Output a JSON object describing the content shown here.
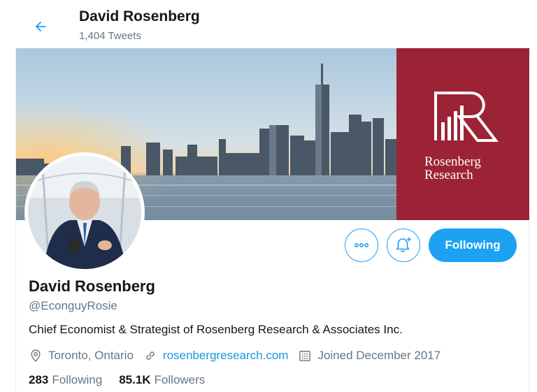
{
  "header": {
    "name": "David Rosenberg",
    "tweet_count": "1,404 Tweets",
    "back_icon": "arrow-left-icon"
  },
  "banner": {
    "brand_line1": "Rosenberg",
    "brand_line2": "Research",
    "brand_color": "#9b2335"
  },
  "actions": {
    "more_icon": "more-dots-icon",
    "notify_icon": "bell-plus-icon",
    "follow_label": "Following"
  },
  "profile": {
    "name": "David Rosenberg",
    "handle": "@EconguyRosie",
    "bio": "Chief Economist & Strategist of Rosenberg Research & Associates Inc.",
    "location": "Toronto, Ontario",
    "website": "rosenbergresearch.com",
    "joined": "Joined December 2017",
    "following_count": "283",
    "following_label": "Following",
    "followers_count": "85.1K",
    "followers_label": "Followers"
  },
  "colors": {
    "accent": "#1da1f2",
    "link": "#1b95e0",
    "muted": "#657786",
    "text": "#14171a"
  }
}
